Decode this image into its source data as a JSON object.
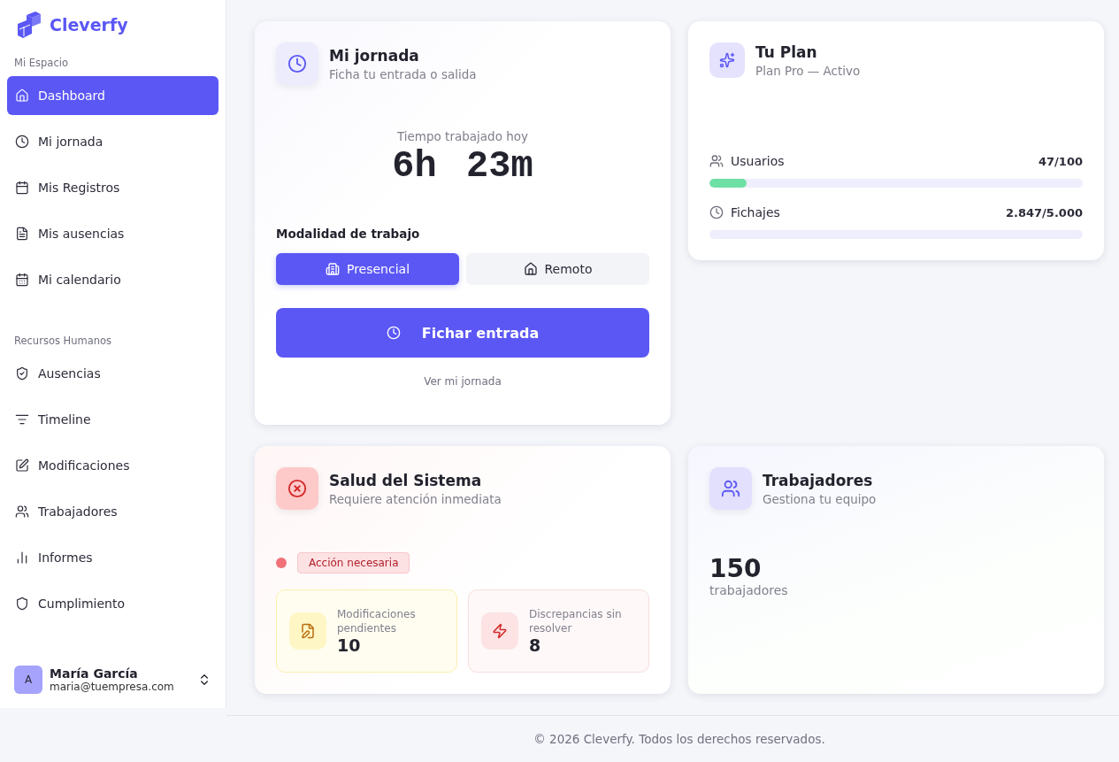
{
  "brand": {
    "name": "Cleverfy"
  },
  "sidebar": {
    "sections": [
      {
        "title": "Mi Espacio",
        "items": [
          {
            "label": "Dashboard",
            "selected": true
          },
          {
            "label": "Mi jornada",
            "selected": false
          },
          {
            "label": "Mis Registros",
            "selected": false
          },
          {
            "label": "Mis ausencias",
            "selected": false
          },
          {
            "label": "Mi calendario",
            "selected": false
          }
        ]
      },
      {
        "title": "Recursos Humanos",
        "items": [
          {
            "label": "Ausencias",
            "selected": false
          },
          {
            "label": "Timeline",
            "selected": false
          },
          {
            "label": "Modificaciones",
            "selected": false
          },
          {
            "label": "Trabajadores",
            "selected": false
          },
          {
            "label": "Informes",
            "selected": false
          },
          {
            "label": "Cumplimiento",
            "selected": false
          }
        ]
      }
    ],
    "user": {
      "initial": "A",
      "name": "María García",
      "email": "maria@tuempresa.com"
    }
  },
  "jornada": {
    "title": "Mi jornada",
    "subtitle": "Ficha tu entrada o salida",
    "time_label": "Tiempo trabajado hoy",
    "hours": "6h",
    "minutes": "23m",
    "mode_label": "Modalidad de trabajo",
    "modes": [
      {
        "label": "Presencial",
        "selected": true
      },
      {
        "label": "Remoto",
        "selected": false
      }
    ],
    "action": "Fichar entrada",
    "link": "Ver mi jornada"
  },
  "plan": {
    "title": "Tu Plan",
    "subtitle": "Plan Pro — Activo",
    "meters": [
      {
        "label": "Usuarios",
        "reading": "47/100",
        "level": 0.1
      },
      {
        "label": "Fichajes",
        "reading": "2.847/5.000"
      }
    ]
  },
  "health": {
    "title": "Salud del Sistema",
    "subtitle": "Requiere atención inmediata",
    "status": {
      "label": "Acción necesaria",
      "color": "#f07178"
    },
    "stats": [
      {
        "kind": "warning",
        "label": "Modificaciones pendientes",
        "value": "10"
      },
      {
        "kind": "danger",
        "label": "Discrepancias sin resolver",
        "value": "8"
      }
    ]
  },
  "workers": {
    "title": "Trabajadores",
    "subtitle": "Gestiona tu equipo",
    "count": "150",
    "unit": "trabajadores"
  },
  "footer": "© 2026 Cleverfy. Todos los derechos reservados."
}
